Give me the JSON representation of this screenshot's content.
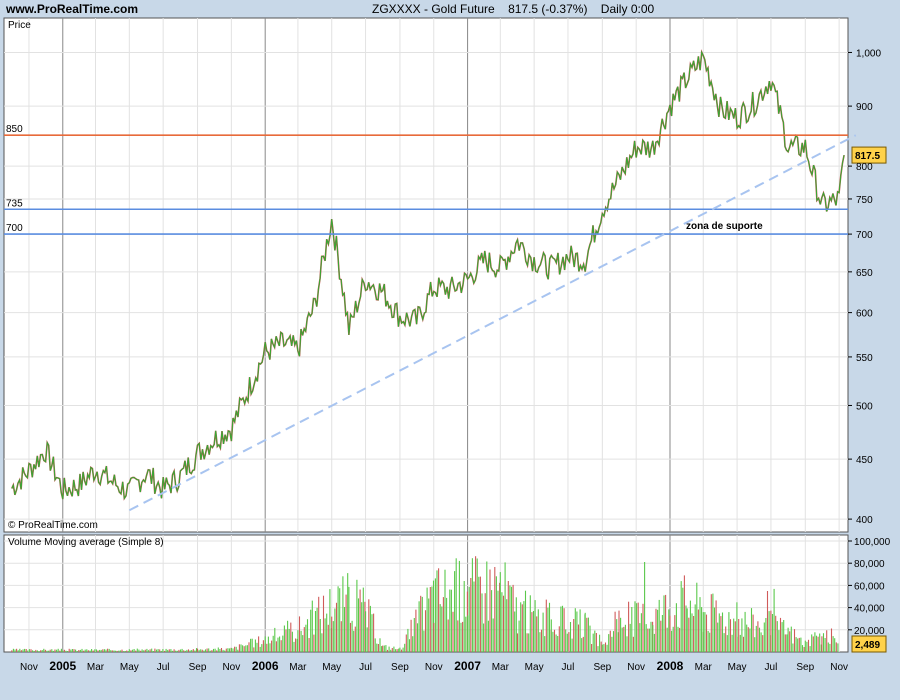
{
  "header": {
    "site": "www.ProRealTime.com",
    "symbol": "ZGXXXX - Gold Future",
    "quote": "817.5 (-0.37%)",
    "period": "Daily",
    "time": "0:00"
  },
  "chart_data": [
    {
      "type": "line",
      "panel_label": "Price",
      "watermark": "© ProRealTime.com",
      "scale": "log",
      "ylim": [
        390,
        1070
      ],
      "y_ticks": [
        400,
        450,
        500,
        550,
        600,
        650,
        700,
        750,
        800,
        900,
        1000
      ],
      "y_tick_labels": [
        "400",
        "450",
        "500",
        "550",
        "600",
        "650",
        "700",
        "750",
        "800",
        "900",
        "1,000"
      ],
      "x_ticks": [
        "Nov",
        "2005",
        "Mar",
        "May",
        "Jul",
        "Sep",
        "Nov",
        "2006",
        "Mar",
        "May",
        "Jul",
        "Sep",
        "Nov",
        "2007",
        "Mar",
        "May",
        "Jul",
        "Sep",
        "Nov",
        "2008",
        "Mar",
        "May",
        "Jul",
        "Sep",
        "Nov"
      ],
      "x_tick_bold": [
        false,
        true,
        false,
        false,
        false,
        false,
        false,
        true,
        false,
        false,
        false,
        false,
        false,
        true,
        false,
        false,
        false,
        false,
        false,
        true,
        false,
        false,
        false,
        false,
        false
      ],
      "x_dates": [
        "2004-11",
        "2005-01",
        "2005-03",
        "2005-05",
        "2005-07",
        "2005-09",
        "2005-11",
        "2006-01",
        "2006-03",
        "2006-05",
        "2006-07",
        "2006-09",
        "2006-11",
        "2007-01",
        "2007-03",
        "2007-05",
        "2007-07",
        "2007-09",
        "2007-11",
        "2008-01",
        "2008-03",
        "2008-05",
        "2008-07",
        "2008-09",
        "2008-11"
      ],
      "series": [
        {
          "color": "#33aa33",
          "points": [
            [
              "2004-10",
              425
            ],
            [
              "2004-11",
              440
            ],
            [
              "2004-12",
              458
            ],
            [
              "2005-01",
              423
            ],
            [
              "2005-02",
              428
            ],
            [
              "2005-03",
              441
            ],
            [
              "2005-04",
              430
            ],
            [
              "2005-05",
              422
            ],
            [
              "2005-06",
              438
            ],
            [
              "2005-07",
              424
            ],
            [
              "2005-08",
              435
            ],
            [
              "2005-09",
              455
            ],
            [
              "2005-10",
              468
            ],
            [
              "2005-11",
              478
            ],
            [
              "2005-12",
              515
            ],
            [
              "2006-01",
              555
            ],
            [
              "2006-02",
              565
            ],
            [
              "2006-03",
              558
            ],
            [
              "2006-04",
              610
            ],
            [
              "2006-05",
              720
            ],
            [
              "2006-06",
              580
            ],
            [
              "2006-07",
              640
            ],
            [
              "2006-08",
              625
            ],
            [
              "2006-09",
              595
            ],
            [
              "2006-10",
              590
            ],
            [
              "2006-11",
              630
            ],
            [
              "2006-12",
              628
            ],
            [
              "2007-01",
              640
            ],
            [
              "2007-02",
              665
            ],
            [
              "2007-03",
              655
            ],
            [
              "2007-04",
              690
            ],
            [
              "2007-05",
              665
            ],
            [
              "2007-06",
              655
            ],
            [
              "2007-07",
              670
            ],
            [
              "2007-08",
              665
            ],
            [
              "2007-09",
              735
            ],
            [
              "2007-10",
              780
            ],
            [
              "2007-11",
              830
            ],
            [
              "2007-12",
              830
            ],
            [
              "2008-01",
              900
            ],
            [
              "2008-02",
              950
            ],
            [
              "2008-03",
              990
            ],
            [
              "2008-04",
              895
            ],
            [
              "2008-05",
              880
            ],
            [
              "2008-06",
              905
            ],
            [
              "2008-07",
              950
            ],
            [
              "2008-08",
              830
            ],
            [
              "2008-09",
              830
            ],
            [
              "2008-10",
              740
            ],
            [
              "2008-11",
              750
            ],
            [
              "2008-11-24",
              817.5
            ]
          ]
        }
      ],
      "horizontal_lines": [
        {
          "value": 850,
          "label": "850",
          "color": "#e86a3a"
        },
        {
          "value": 735,
          "label": "735",
          "color": "#5b8de0"
        },
        {
          "value": 700,
          "label": "700",
          "color": "#5b8de0"
        }
      ],
      "trendline": {
        "from": [
          "2005-05",
          407
        ],
        "to": [
          "2008-12",
          850
        ],
        "color": "#a8c4f0",
        "style": "dashed"
      },
      "annotations": [
        {
          "text": "zona de suporte",
          "color": "#4a80d8"
        }
      ],
      "last_value_badge": "817.5"
    },
    {
      "type": "bar",
      "panel_label": "Volume Moving average (Simple 8)",
      "ylim": [
        0,
        100000
      ],
      "y_tick_labels": [
        "100,000",
        "80,000",
        "60,000",
        "40,000",
        "20,000"
      ],
      "y_ticks": [
        100000,
        80000,
        60000,
        40000,
        20000
      ],
      "last_value_badge": "2,489",
      "volume_profile": [
        [
          "2004-10",
          2000
        ],
        [
          "2005-01",
          2000
        ],
        [
          "2005-05",
          2000
        ],
        [
          "2005-09",
          2500
        ],
        [
          "2005-11",
          3000
        ],
        [
          "2006-01",
          12000
        ],
        [
          "2006-03",
          22000
        ],
        [
          "2006-05",
          45000
        ],
        [
          "2006-06",
          50000
        ],
        [
          "2006-07",
          40000
        ],
        [
          "2006-08",
          5000
        ],
        [
          "2006-09",
          3000
        ],
        [
          "2006-11",
          55000
        ],
        [
          "2007-01",
          60000
        ],
        [
          "2007-03",
          65000
        ],
        [
          "2007-04",
          40000
        ],
        [
          "2007-06",
          30000
        ],
        [
          "2007-08",
          25000
        ],
        [
          "2007-09",
          5000
        ],
        [
          "2007-10",
          30000
        ],
        [
          "2007-12",
          35000
        ],
        [
          "2008-01",
          45000
        ],
        [
          "2008-02",
          50000
        ],
        [
          "2008-03",
          40000
        ],
        [
          "2008-05",
          30000
        ],
        [
          "2008-07",
          25000
        ],
        [
          "2008-08",
          20000
        ],
        [
          "2008-09",
          8000
        ],
        [
          "2008-10",
          15000
        ],
        [
          "2008-11",
          14000
        ]
      ]
    }
  ]
}
